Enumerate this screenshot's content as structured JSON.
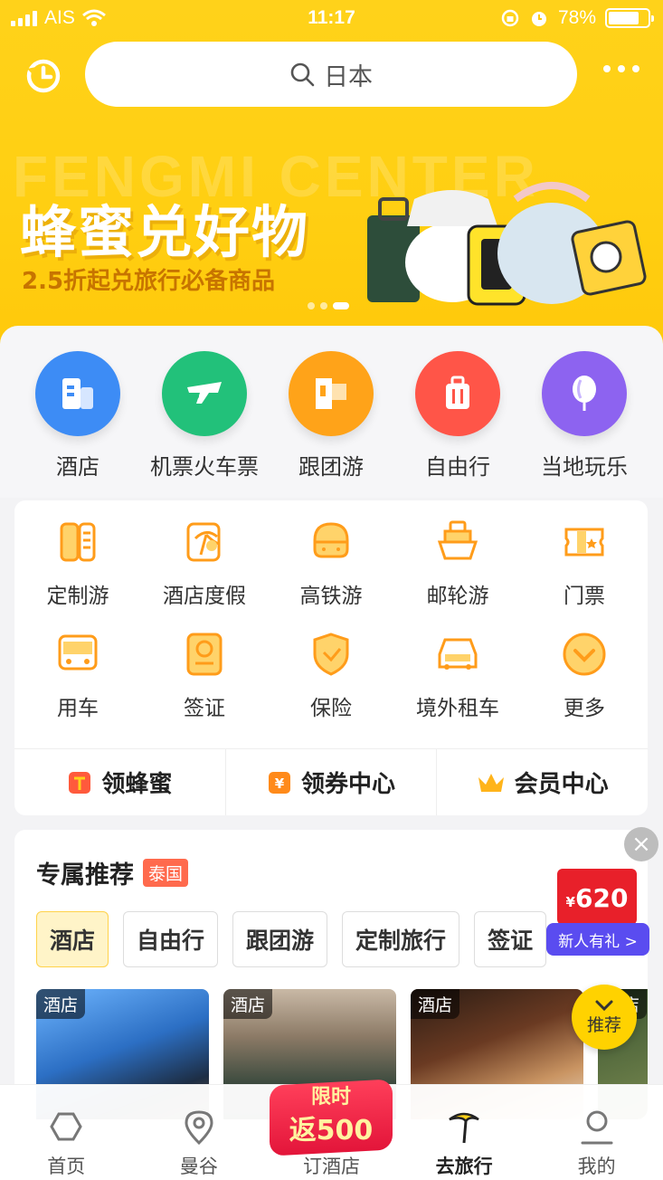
{
  "status_bar": {
    "carrier": "AIS",
    "time": "11:17",
    "battery": "78%"
  },
  "search": {
    "placeholder": "日本"
  },
  "banner": {
    "ghost_text": "FENGMI CENTER",
    "title": "蜂蜜兑好物",
    "subtitle": "2.5折起兑旅行必备商品"
  },
  "primary_categories": [
    {
      "label": "酒店",
      "icon": "hotel-icon",
      "color": "#3d8cf5"
    },
    {
      "label": "机票火车票",
      "icon": "plane-train-icon",
      "color": "#22c17a"
    },
    {
      "label": "跟团游",
      "icon": "flag-icon",
      "color": "#ffa319"
    },
    {
      "label": "自由行",
      "icon": "luggage-icon",
      "color": "#ff5548"
    },
    {
      "label": "当地玩乐",
      "icon": "balloon-icon",
      "color": "#8d63f0"
    }
  ],
  "secondary_categories": [
    {
      "label": "定制游",
      "icon": "custom-tour-icon"
    },
    {
      "label": "酒店度假",
      "icon": "resort-icon"
    },
    {
      "label": "高铁游",
      "icon": "high-speed-rail-icon"
    },
    {
      "label": "邮轮游",
      "icon": "cruise-icon"
    },
    {
      "label": "门票",
      "icon": "ticket-icon"
    },
    {
      "label": "用车",
      "icon": "bus-icon"
    },
    {
      "label": "签证",
      "icon": "passport-icon"
    },
    {
      "label": "保险",
      "icon": "shield-icon"
    },
    {
      "label": "境外租车",
      "icon": "car-icon"
    },
    {
      "label": "更多",
      "icon": "more-chevron-icon"
    }
  ],
  "quick_links": [
    {
      "label": "领蜂蜜",
      "icon": "honey-icon"
    },
    {
      "label": "领券中心",
      "icon": "coupon-icon"
    },
    {
      "label": "会员中心",
      "icon": "crown-icon"
    }
  ],
  "recommend": {
    "title": "专属推荐",
    "region_tag": "泰国",
    "tabs": [
      "酒店",
      "自由行",
      "跟团游",
      "定制旅行",
      "签证"
    ],
    "cards": [
      {
        "badge": "酒店"
      },
      {
        "badge": "酒店"
      },
      {
        "badge": "酒店"
      },
      {
        "badge": "酒店"
      }
    ]
  },
  "floating": {
    "gift_amount": "620",
    "gift_currency": "¥",
    "gift_label": "新人有礼 >",
    "recommend_label": "推荐"
  },
  "promo_badge": {
    "line1": "限时",
    "line2": "返500"
  },
  "tab_bar": [
    {
      "label": "首页",
      "icon": "home-icon"
    },
    {
      "label": "曼谷",
      "icon": "location-icon"
    },
    {
      "label": "订酒店",
      "icon": "hotel-tab-icon"
    },
    {
      "label": "去旅行",
      "icon": "palm-tree-icon"
    },
    {
      "label": "我的",
      "icon": "profile-icon"
    }
  ],
  "colors": {
    "brand_yellow": "#ffd21a",
    "accent_orange": "#ff9c1a",
    "text": "#222222"
  }
}
